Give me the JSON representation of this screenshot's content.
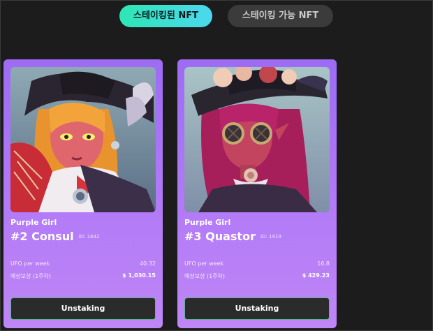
{
  "tabs": {
    "staked_label": "스테이킹된 NFT",
    "available_label": "스테이킹 가능 NFT"
  },
  "cards": [
    {
      "collection": "Purple Girl",
      "title": "#2 Consul",
      "id_text": "ID: 1642",
      "rate_label": "UFO per week",
      "rate_value": "40.32",
      "reward_label": "예상보상 (1주차)",
      "reward_value": "$ 1,030.15",
      "button_label": "Unstaking"
    },
    {
      "collection": "Purple Girl",
      "title": "#3 Quastor",
      "id_text": "ID: 1919",
      "rate_label": "UFO per week",
      "rate_value": "16.8",
      "reward_label": "예상보상 (1주차)",
      "reward_value": "$ 429.23",
      "button_label": "Unstaking"
    }
  ],
  "colors": {
    "background": "#1c1c1c",
    "card_gradient_top": "#9d6cf4",
    "card_gradient_bottom": "#bf86f6",
    "active_tab_start": "#2ee6b4",
    "active_tab_end": "#4bd8ef",
    "inactive_tab": "#3b3b3b",
    "button_bg": "#2b2b2b",
    "button_border": "#52b88c"
  }
}
